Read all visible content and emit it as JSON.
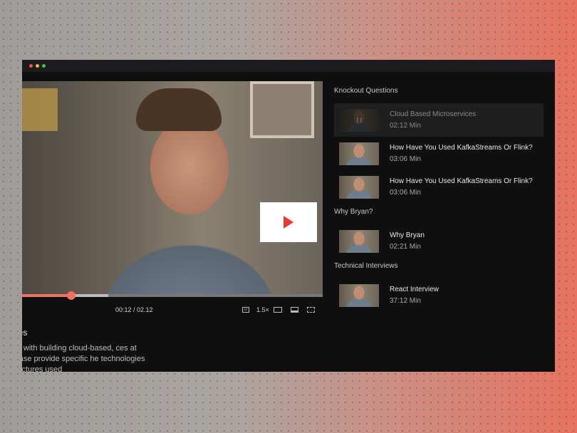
{
  "player": {
    "time": "00:12 / 02.12",
    "speed": "1.5×",
    "progress_fraction": 0.094,
    "buffered_fraction": 0.287
  },
  "description": {
    "title": "vices",
    "text": "experience with building cloud-based, ces at scale? Please provide specific he technologies and architectures used"
  },
  "playlist": {
    "sections": [
      {
        "title": "Knockout Questions",
        "items": [
          {
            "title": "Cloud Based Microservices",
            "duration": "02:12 Min",
            "active": true
          },
          {
            "title": "How Have You Used KafkaStreams Or Flink?",
            "duration": "03:06 Min"
          },
          {
            "title": "How Have You Used KafkaStreams Or Flink?",
            "duration": "03:06 Min"
          }
        ]
      },
      {
        "title": "Why Bryan?",
        "items": [
          {
            "title": "Why Bryan",
            "duration": "02:21 Min"
          }
        ]
      },
      {
        "title": "Technical Interviews",
        "items": [
          {
            "title": "React Interview",
            "duration": "37:12 Min"
          }
        ]
      }
    ]
  },
  "colors": {
    "accent": "#f2705d",
    "play": "#e53a2f"
  }
}
